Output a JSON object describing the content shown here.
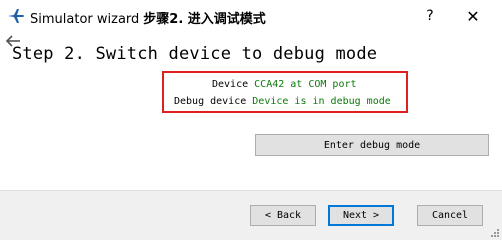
{
  "window": {
    "title": "Simulator wizard",
    "title_cn": "步骤2. 进入调试模式",
    "help_glyph": "?",
    "close_glyph": "✕"
  },
  "step": {
    "title": "Step 2. Switch device to debug mode"
  },
  "status": {
    "device_label": "Device",
    "device_value": "CCA42 at COM port",
    "debug_label": "Debug device",
    "debug_value": "Device is in debug mode",
    "value_color": "#0a7a0a",
    "box_color": "#e02020"
  },
  "actions": {
    "enter_debug_label": "Enter debug mode"
  },
  "footer": {
    "back_label": "< Back",
    "next_label": "Next >",
    "cancel_label": "Cancel"
  },
  "icons": {
    "app": "airplane-icon",
    "back": "back-arrow-icon"
  }
}
